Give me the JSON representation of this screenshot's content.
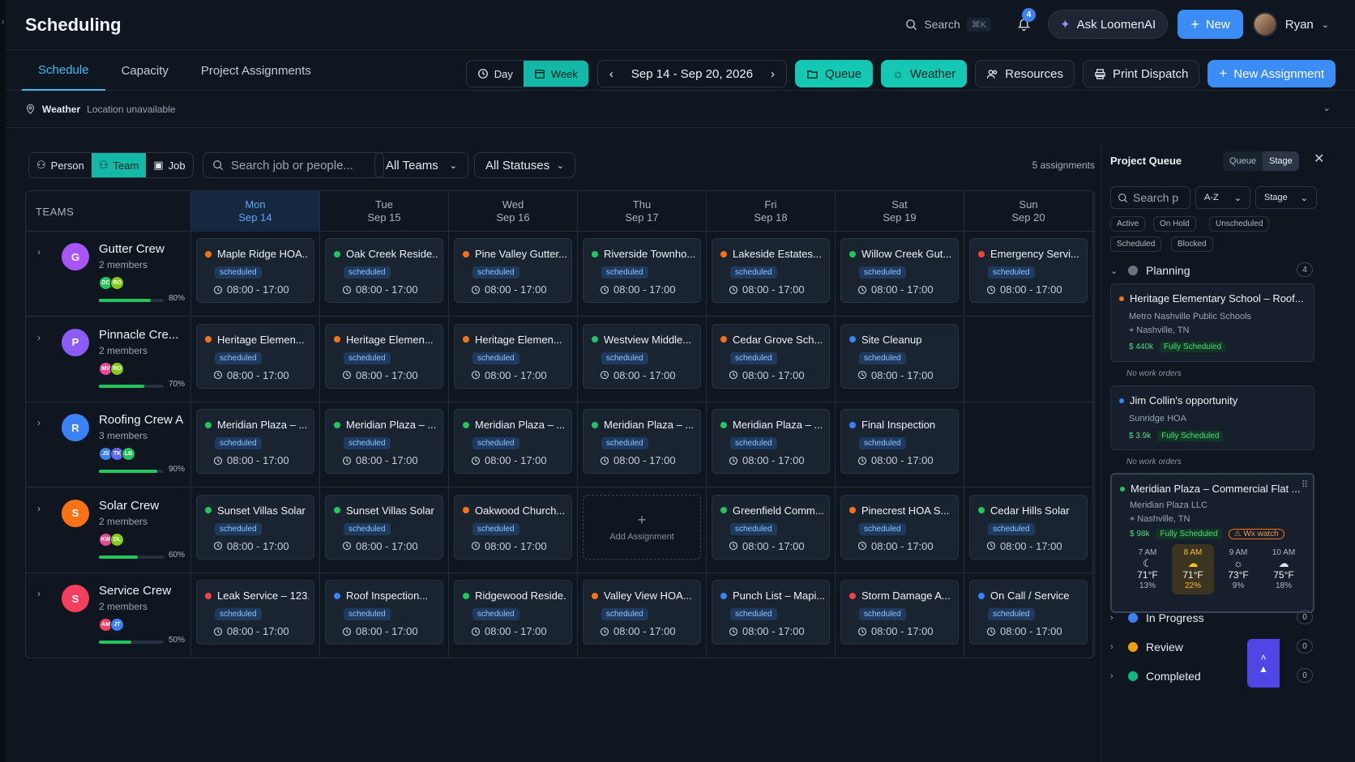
{
  "header": {
    "title": "Scheduling",
    "search_label": "Search",
    "search_kbd": "⌘K",
    "notif_count": "4",
    "ask_label": "Ask LoomenAI",
    "new_label": "New",
    "user_name": "Ryan"
  },
  "tabs": [
    "Schedule",
    "Capacity",
    "Project Assignments"
  ],
  "toolbar": {
    "day": "Day",
    "week": "Week",
    "range": "Sep 14 - Sep 20, 2026",
    "queue": "Queue",
    "weather": "Weather",
    "resources": "Resources",
    "print": "Print Dispatch",
    "new_assignment": "New Assignment"
  },
  "weather_bar": {
    "label": "Weather",
    "status": "Location unavailable"
  },
  "filters": {
    "person": "Person",
    "team": "Team",
    "job": "Job",
    "search_placeholder": "Search job or people...",
    "teams": "All Teams",
    "statuses": "All Statuses",
    "count": "5 assignments"
  },
  "grid": {
    "teams_header": "TEAMS",
    "days": [
      {
        "d": "Mon",
        "date": "Sep 14"
      },
      {
        "d": "Tue",
        "date": "Sep 15"
      },
      {
        "d": "Wed",
        "date": "Sep 16"
      },
      {
        "d": "Thu",
        "date": "Sep 17"
      },
      {
        "d": "Fri",
        "date": "Sep 18"
      },
      {
        "d": "Sat",
        "date": "Sep 19"
      },
      {
        "d": "Sun",
        "date": "Sep 20"
      }
    ],
    "badge": "scheduled",
    "time": "08:00 - 17:00",
    "add_label": "Add Assignment",
    "teams": [
      {
        "initial": "G",
        "name": "Gutter Crew",
        "members": "2 members",
        "color": "#a855f7",
        "chips": [
          [
            "DC",
            "#22c55e"
          ],
          [
            "RO",
            "#84cc16"
          ]
        ],
        "util": 80,
        "util_label": "80%",
        "jobs": [
          [
            "Maple Ridge HOA...",
            "#f97316"
          ],
          [
            "Oak Creek Reside...",
            "#22c55e"
          ],
          [
            "Pine Valley Gutter...",
            "#f97316"
          ],
          [
            "Riverside Townho...",
            "#22c55e"
          ],
          [
            "Lakeside Estates...",
            "#f97316"
          ],
          [
            "Willow Creek Gut...",
            "#22c55e"
          ],
          [
            "Emergency Servi...",
            "#ef4444"
          ]
        ]
      },
      {
        "initial": "P",
        "name": "Pinnacle Cre...",
        "members": "2 members",
        "color": "#8b5cf6",
        "chips": [
          [
            "MV",
            "#ec4899"
          ],
          [
            "RO",
            "#84cc16"
          ]
        ],
        "util": 70,
        "util_label": "70%",
        "jobs": [
          [
            "Heritage Elemen...",
            "#f97316"
          ],
          [
            "Heritage Elemen...",
            "#f97316"
          ],
          [
            "Heritage Elemen...",
            "#f97316"
          ],
          [
            "Westview Middle...",
            "#22c55e"
          ],
          [
            "Cedar Grove Sch...",
            "#f97316"
          ],
          [
            "Site Cleanup",
            "#3b82f6"
          ],
          null
        ]
      },
      {
        "initial": "R",
        "name": "Roofing Crew A",
        "members": "3 members",
        "color": "#3b82f6",
        "chips": [
          [
            "JS",
            "#3b82f6"
          ],
          [
            "TK",
            "#6366f1"
          ],
          [
            "LB",
            "#22c55e"
          ]
        ],
        "util": 90,
        "util_label": "90%",
        "jobs": [
          [
            "Meridian Plaza – ...",
            "#22c55e"
          ],
          [
            "Meridian Plaza – ...",
            "#22c55e"
          ],
          [
            "Meridian Plaza – ...",
            "#22c55e"
          ],
          [
            "Meridian Plaza – ...",
            "#22c55e"
          ],
          [
            "Meridian Plaza – ...",
            "#22c55e"
          ],
          [
            "Final Inspection",
            "#3b82f6"
          ],
          null
        ]
      },
      {
        "initial": "S",
        "name": "Solar Crew",
        "members": "2 members",
        "color": "#f97316",
        "chips": [
          [
            "KW",
            "#ec4899"
          ],
          [
            "DL",
            "#84cc16"
          ]
        ],
        "util": 60,
        "util_label": "60%",
        "jobs": [
          [
            "Sunset Villas Solar",
            "#22c55e"
          ],
          [
            "Sunset Villas Solar",
            "#22c55e"
          ],
          [
            "Oakwood Church...",
            "#f97316"
          ],
          "add",
          [
            "Greenfield Comm...",
            "#22c55e"
          ],
          [
            "Pinecrest HOA S...",
            "#f97316"
          ],
          [
            "Cedar Hills Solar",
            "#22c55e"
          ]
        ]
      },
      {
        "initial": "S",
        "name": "Service Crew",
        "members": "2 members",
        "color": "#f43f5e",
        "chips": [
          [
            "AM",
            "#f43f5e"
          ],
          [
            "JT",
            "#3b82f6"
          ]
        ],
        "util": 50,
        "util_label": "50%",
        "jobs": [
          [
            "Leak Service – 123...",
            "#ef4444"
          ],
          [
            "Roof Inspection...",
            "#3b82f6"
          ],
          [
            "Ridgewood Reside...",
            "#22c55e"
          ],
          [
            "Valley View HOA...",
            "#f97316"
          ],
          [
            "Punch List – Mapi...",
            "#3b82f6"
          ],
          [
            "Storm Damage A...",
            "#ef4444"
          ],
          [
            "On Call / Service",
            "#3b82f6"
          ]
        ]
      }
    ]
  },
  "queue": {
    "title": "Project Queue",
    "seg": [
      "Queue",
      "Stage"
    ],
    "search_placeholder": "Search p",
    "sort": "A-Z",
    "group": "Stage",
    "pills": [
      "Active",
      "On Hold",
      "Unscheduled",
      "Scheduled",
      "Blocked"
    ],
    "groups": [
      {
        "label": "Planning",
        "count": "4",
        "color": "#6b7280"
      },
      {
        "label": "In Progress",
        "count": "0",
        "color": "#3b82f6"
      },
      {
        "label": "Review",
        "count": "0",
        "color": "#f59e0b"
      },
      {
        "label": "Completed",
        "count": "0",
        "color": "#10b981"
      }
    ],
    "no_work": "No work orders",
    "cards": [
      {
        "title": "Heritage Elementary School – Roof...",
        "org": "Metro Nashville Public Schools",
        "loc": "Nashville, TN",
        "amount": "$ 440k",
        "status": "Fully Scheduled",
        "dot": "#f97316"
      },
      {
        "title": "Jim Collin's opportunity",
        "org": "Sunridge HOA",
        "amount": "$ 3.9k",
        "status": "Fully Scheduled",
        "dot": "#3b82f6"
      },
      {
        "title": "Meridian Plaza – Commercial Flat ...",
        "org": "Meridian Plaza LLC",
        "loc": "Nashville, TN",
        "amount": "$ 98k",
        "status": "Fully Scheduled",
        "wx": "Wx watch",
        "dot": "#22c55e",
        "hours": [
          {
            "t": "7 AM",
            "icon": "moon-icon",
            "temp": "71°F",
            "p": "13%"
          },
          {
            "t": "8 AM",
            "icon": "cloud-icon",
            "temp": "71°F",
            "p": "22%"
          },
          {
            "t": "9 AM",
            "icon": "sun-icon",
            "temp": "73°F",
            "p": "9%"
          },
          {
            "t": "10 AM",
            "icon": "cloud-icon",
            "temp": "75°F",
            "p": "18%"
          }
        ]
      }
    ]
  }
}
